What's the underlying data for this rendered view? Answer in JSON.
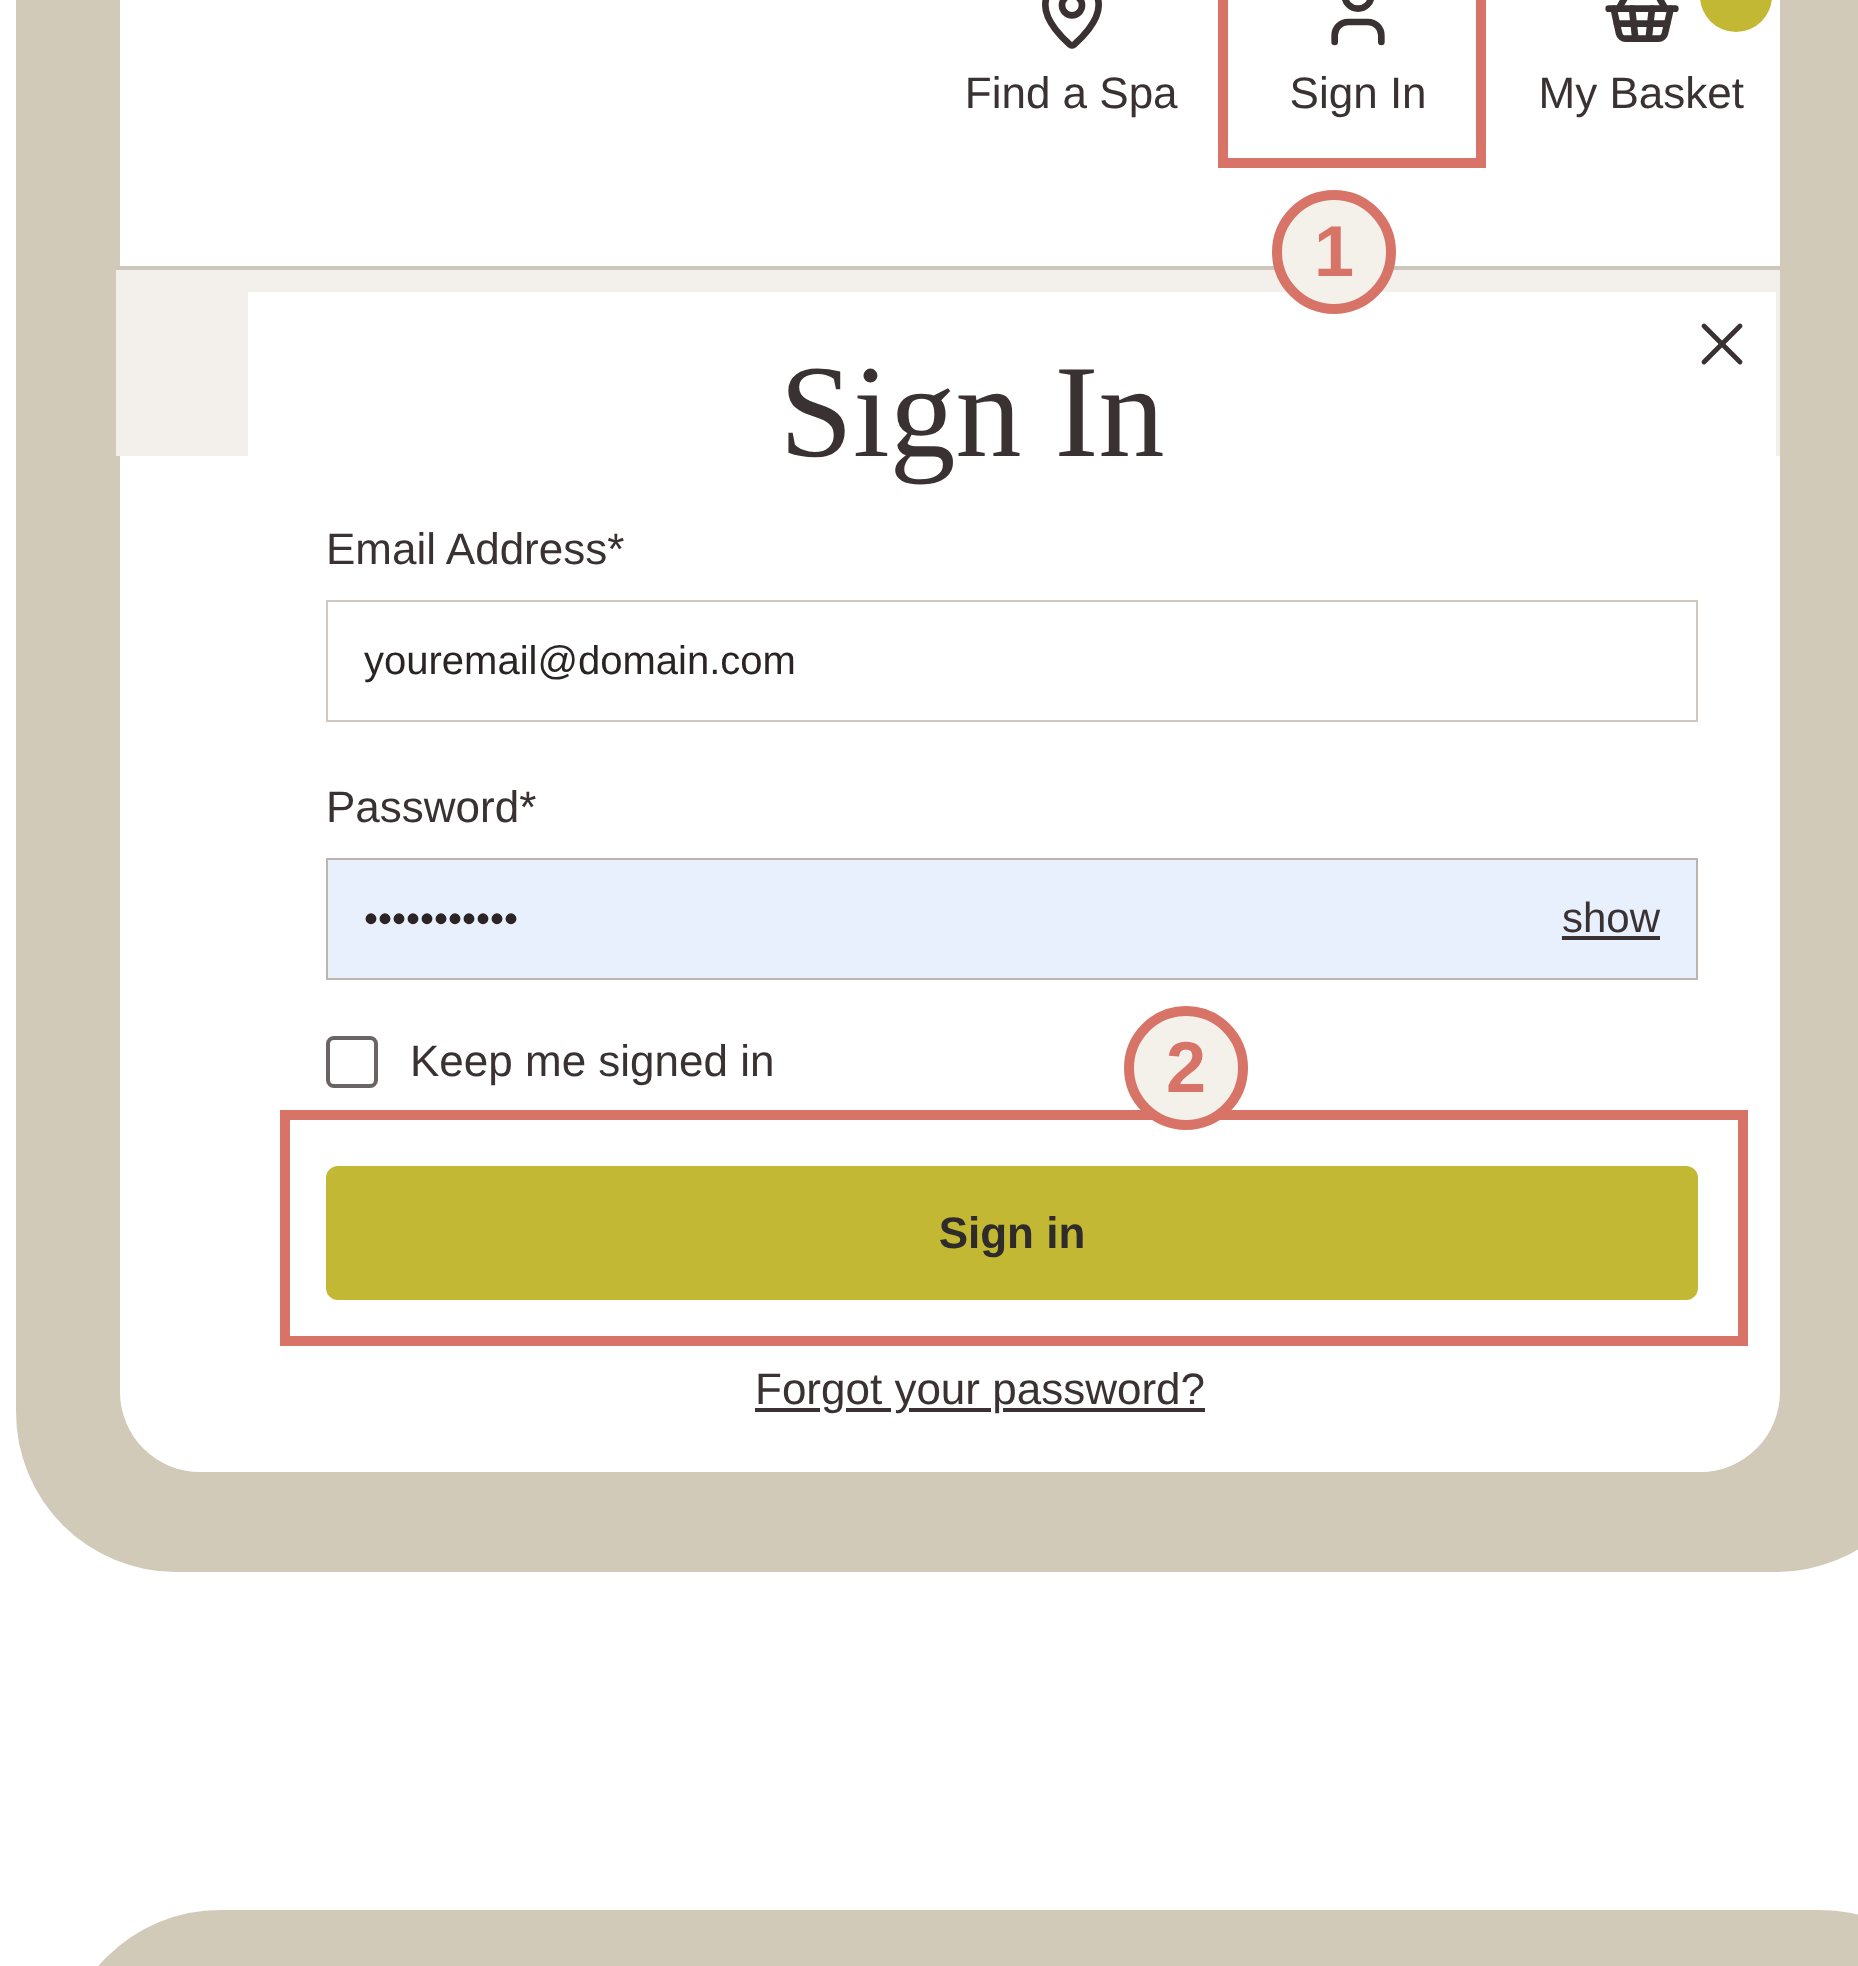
{
  "nav": [
    {
      "kind": "pin",
      "label": "Find a Spa",
      "highlighted": false,
      "badge": false
    },
    {
      "kind": "person",
      "label": "Sign In",
      "highlighted": true,
      "badge": false
    },
    {
      "kind": "basket",
      "label": "My Basket",
      "highlighted": false,
      "badge": true
    }
  ],
  "callouts": [
    {
      "number": "1"
    },
    {
      "number": "2"
    }
  ],
  "modal": {
    "title": "Sign In",
    "fields": [
      {
        "label": "Email Address*",
        "value": "youremail@domain.com",
        "autofilled": false
      },
      {
        "label": "Password*",
        "value": "•••••••••••",
        "autofilled": true,
        "toggle": "show"
      }
    ],
    "remember": {
      "label": "Keep me signed in",
      "checked": false
    },
    "submit": {
      "label": "Sign in",
      "highlighted": true
    },
    "forgot_link": "Forgot your password?"
  }
}
